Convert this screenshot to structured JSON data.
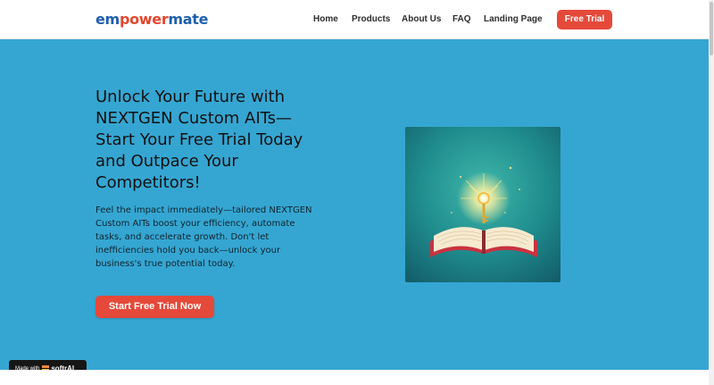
{
  "header": {
    "logo": {
      "part1": "em",
      "part2": "power",
      "part3": "mate"
    },
    "nav": [
      {
        "label": "Home"
      },
      {
        "label": "Products"
      },
      {
        "label": "About Us"
      },
      {
        "label": "FAQ"
      },
      {
        "label": "Landing Page"
      }
    ],
    "cta_label": "Free Trial"
  },
  "hero": {
    "headline": "Unlock Your Future with NEXTGEN Custom AITs—Start Your Free Trial Today and Outpace Your Competitors!",
    "subtext": "Feel the impact immediately—tailored NEXTGEN Custom AITs boost your efficiency, automate tasks, and accelerate growth. Don't let inefficiencies hold you back—unlock your business's true potential today.",
    "cta_label": "Start Free Trial Now"
  },
  "badge": {
    "made_with": "Made with",
    "brand": "softrAI"
  },
  "colors": {
    "hero_background": "#35a6d2",
    "accent": "#e5493a",
    "logo_blue": "#1f5fae",
    "logo_red": "#e4472f"
  }
}
